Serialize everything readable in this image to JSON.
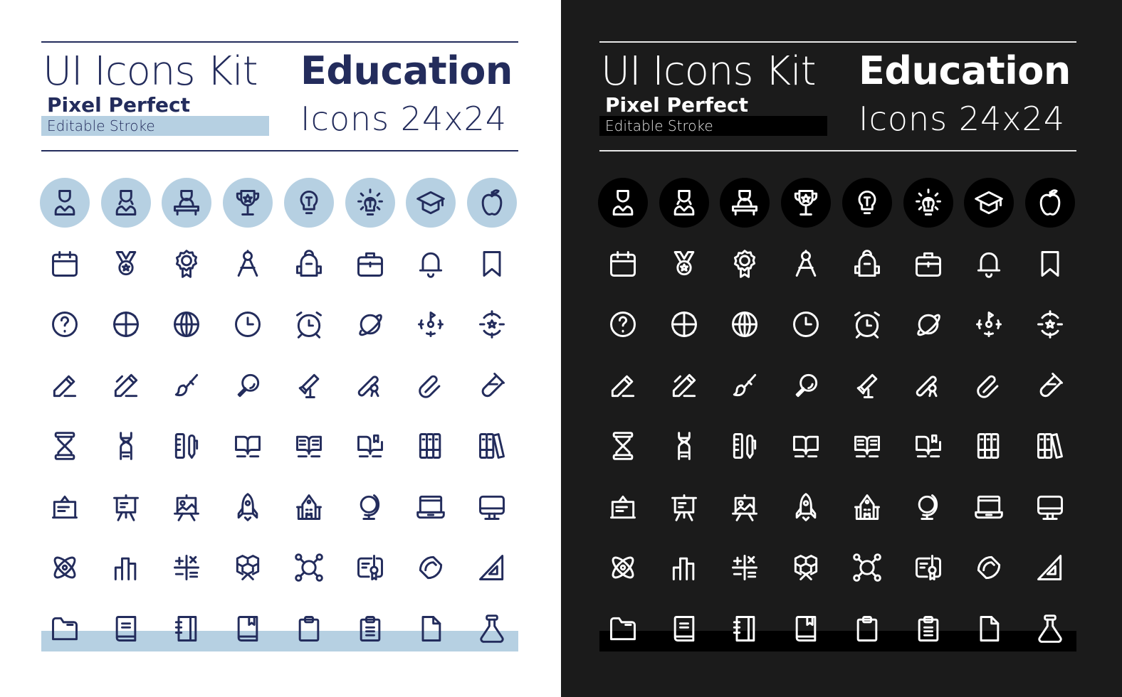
{
  "header": {
    "kit_title": "UI Icons Kit",
    "pixel_perfect": "Pixel Perfect",
    "editable_stroke": "Editable Stroke",
    "category": "Education",
    "size_label": "Icons 24x24"
  },
  "themes": [
    {
      "name": "light",
      "background": "#ffffff",
      "stroke": "#232c5c",
      "accent": "#b6d0e2"
    },
    {
      "name": "dark",
      "background": "#1b1b1b",
      "stroke": "#ffffff",
      "accent": "#000000"
    }
  ],
  "icons": [
    [
      "graduate-male-icon",
      "graduate-female-icon",
      "graduate-lectern-icon",
      "trophy-star-icon",
      "lightbulb-icon",
      "lightbulb-shining-icon",
      "graduation-cap-icon",
      "apple-icon"
    ],
    [
      "calendar-icon",
      "medal-icon",
      "award-rosette-icon",
      "compass-drawing-icon",
      "backpack-icon",
      "briefcase-icon",
      "bell-icon",
      "bookmark-icon"
    ],
    [
      "question-icon",
      "basketball-icon",
      "globe-icon",
      "clock-icon",
      "alarm-clock-icon",
      "planet-icon",
      "target-flag-icon",
      "target-star-icon"
    ],
    [
      "pencil-icon",
      "pen-icon",
      "paintbrush-icon",
      "magnifier-icon",
      "telescope-icon",
      "diploma-scroll-icon",
      "paperclip-icon",
      "test-tube-icon"
    ],
    [
      "hourglass-icon",
      "dna-icon",
      "ruler-pencil-icon",
      "open-book-icon",
      "open-book-text-icon",
      "open-book-bookmark-icon",
      "binders-icon",
      "books-shelf-icon"
    ],
    [
      "notice-board-icon",
      "presentation-easel-icon",
      "art-easel-icon",
      "rocket-icon",
      "school-building-icon",
      "desk-globe-icon",
      "laptop-icon",
      "monitor-icon"
    ],
    [
      "atom-icon",
      "bar-chart-icon",
      "math-symbols-icon",
      "hexagon-molecule-icon",
      "molecule-network-icon",
      "certificate-icon",
      "protractor-icon",
      "set-square-icon"
    ],
    [
      "folder-icon",
      "book-icon",
      "notebook-icon",
      "book-bookmark-icon",
      "clipboard-icon",
      "clipboard-list-icon",
      "document-icon",
      "flask-icon"
    ]
  ]
}
